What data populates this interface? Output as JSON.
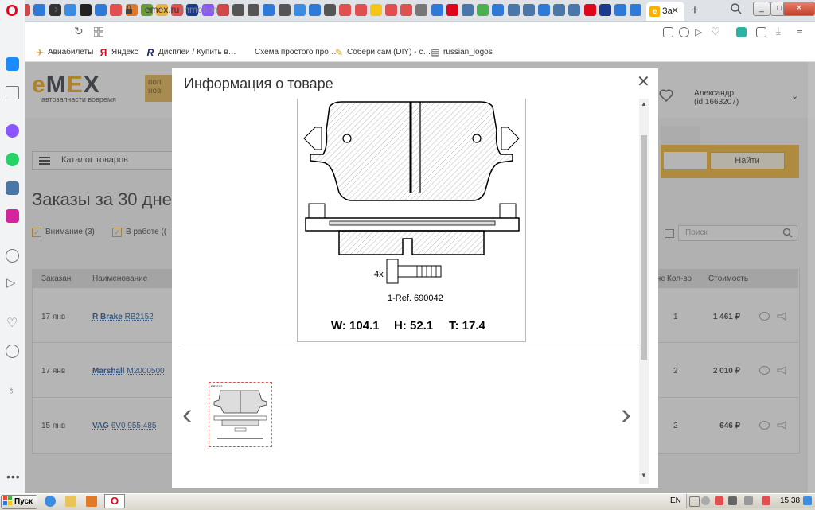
{
  "browser": {
    "active_tab_title": "За",
    "url_domain": "emex.ru",
    "url_path": "/inmotion",
    "bookmarks": [
      {
        "label": "Авиабилеты",
        "icon": "plane-icon"
      },
      {
        "label": "Яндекс",
        "icon": "yandex-icon"
      },
      {
        "label": "Дисплеи / Купить в…",
        "icon": "r-icon"
      },
      {
        "label": "Схема простого про…",
        "icon": ""
      },
      {
        "label": "Собери сам (DIY) - с…",
        "icon": "pencil-icon"
      },
      {
        "label": "russian_logos",
        "icon": "file-icon"
      }
    ]
  },
  "site": {
    "logo_text_1": "e",
    "logo_text_2": "M",
    "logo_text_3": "E",
    "logo_text_4": "X",
    "tagline": "автозапчасти вовремя",
    "promo_line1": "поп",
    "promo_line2": "нов",
    "user_name": "Александр",
    "user_id": "(id 1663207)",
    "catalog_label": "Каталог товаров",
    "search_button": "Найти",
    "heading": "Заказы за 30 дне",
    "filters": [
      "Внимание (3)",
      "В работе (("
    ],
    "search_placeholder": "Поиск"
  },
  "table": {
    "headers": [
      "Заказан",
      "Наименование",
      "че",
      "Кол-во",
      "Стоимость"
    ],
    "rows": [
      {
        "date": "17 янв",
        "brand": "R Brake",
        "article": "RB2152",
        "qty": "1",
        "cost": "1 461 ₽"
      },
      {
        "date": "17 янв",
        "brand": "Marshall",
        "article": "M2000500",
        "qty": "2",
        "cost": "2 010 ₽"
      },
      {
        "date": "15 янв",
        "brand": "VAG",
        "article": "6V0 955 485",
        "qty": "2",
        "cost": "646 ₽"
      }
    ]
  },
  "modal": {
    "title": "Информация о товаре",
    "bolt_count": "4x",
    "reference": "1-Ref. 690042",
    "dimensions": {
      "w": "W: 104.1",
      "h": "H: 52.1",
      "t": "T: 17.4"
    },
    "thumb_label": "RB2152"
  },
  "taskbar": {
    "start": "Пуск",
    "lang": "EN",
    "time": "15:38"
  }
}
